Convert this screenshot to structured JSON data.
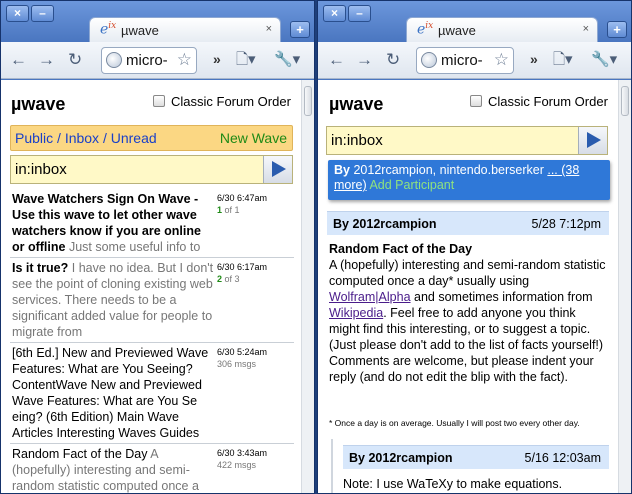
{
  "tab": {
    "icon_text": "e",
    "icon_sup": "ix",
    "title": "µwave",
    "close": "×"
  },
  "window_buttons": {
    "close": "×",
    "minimize": "–",
    "new_tab": "+"
  },
  "omnibox": {
    "url": "micro-"
  },
  "app": {
    "title": "µwave",
    "classic_order": "Classic Forum Order"
  },
  "left": {
    "filter": {
      "public": "Public",
      "inbox": "Inbox",
      "unread": "Unread",
      "separator": "/",
      "new_wave": "New Wave"
    },
    "search": {
      "query": "in:inbox"
    },
    "waves": [
      {
        "title": "Wave Watchers Sign On Wave - Use this wave to let other wave watchers know if you are online or offline",
        "snippet": "Just some useful info to have:",
        "date": "6/30 6:47am",
        "unread": "1",
        "of": "of 1"
      },
      {
        "title": "Is it true?",
        "snippet": "I have no idea. But I don't see the point of cloning existing web services. There needs to be a significant added value for people to migrate from Facebook/Twitter/Foursquare to a different",
        "date": "6/30 6:17am",
        "unread": "2",
        "of": "of 3"
      },
      {
        "title": "",
        "snippet": "[6th Ed.] New and Previewed Wave Features: What are You Seeing? ContentWave New and Previewed Wave Features: What are You Se eing? (6th Edition) Main Wave Articles Interesting Waves Guides About By",
        "date": "6/30 5:24am",
        "unread": "",
        "of": "306 msgs"
      },
      {
        "title": "Random Fact of the Day",
        "snippet": "A (hopefully) interesting and semi-random statistic computed once a day* usually",
        "date": "6/30 3:43am",
        "unread": "",
        "of": "422 msgs"
      }
    ]
  },
  "right": {
    "search": {
      "query": "in:inbox"
    },
    "participants": {
      "by": "By",
      "names": "2012rcampion, nintendo.berserker",
      "more": "... (38 more)",
      "add": "Add Participant"
    },
    "blip": {
      "by": "By",
      "author": "2012rcampion",
      "time": "5/28 7:12pm",
      "title": "Random Fact of the Day",
      "p1": "A (hopefully) interesting and semi-random statistic computed once a day* usually using",
      "link1": "Wolfram|Alpha",
      "p2": "and sometimes information from",
      "link2": "Wikipedia",
      "p3": ". Feel free to add anyone you think might find this interesting, or to suggest a topic. (Just please don't add to the list of facts yourself!) Comments are welcome, but please indent your reply (and do not edit the blip with the fact).",
      "footnote": "* Once a day is on average. Usually I will post two every other day."
    },
    "reply": {
      "by": "By",
      "author": "2012rcampion",
      "time": "5/16 12:03am",
      "body": "Note: I use WaTeXy to make equations."
    }
  }
}
